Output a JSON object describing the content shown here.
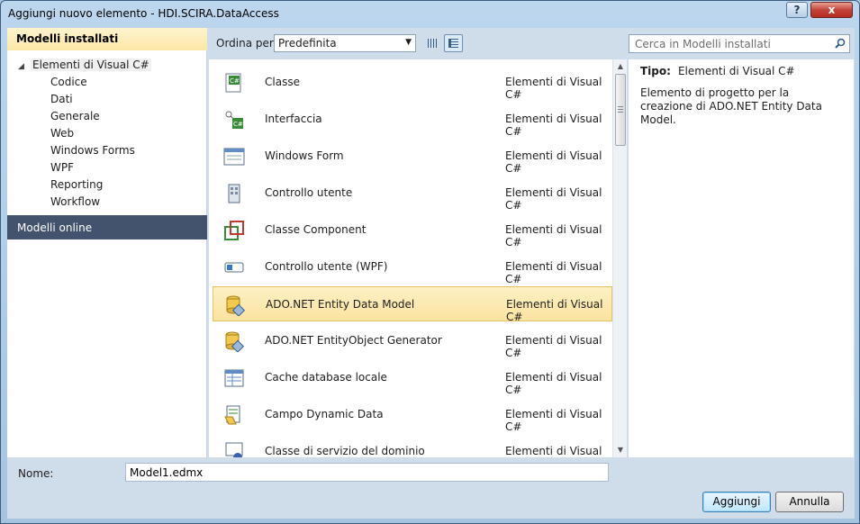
{
  "window": {
    "title": "Aggiungi nuovo elemento - HDI.SCIRA.DataAccess",
    "help_label": "?",
    "close_label": "x"
  },
  "sidebar": {
    "installed_header": "Modelli installati",
    "root_label": "Elementi di Visual C#",
    "children": [
      "Codice",
      "Dati",
      "Generale",
      "Web",
      "Windows Forms",
      "WPF",
      "Reporting",
      "Workflow"
    ],
    "online_header": "Modelli online"
  },
  "toolbar": {
    "sort_label": "Ordina per:",
    "sort_value": "Predefinita",
    "search_placeholder": "Cerca in Modelli installati"
  },
  "templates": [
    {
      "name": "Classe",
      "category": "Elementi di Visual C#",
      "icon": "class-icon"
    },
    {
      "name": "Interfaccia",
      "category": "Elementi di Visual C#",
      "icon": "interface-icon"
    },
    {
      "name": "Windows Form",
      "category": "Elementi di Visual C#",
      "icon": "windows-form-icon"
    },
    {
      "name": "Controllo utente",
      "category": "Elementi di Visual C#",
      "icon": "user-control-icon"
    },
    {
      "name": "Classe Component",
      "category": "Elementi di Visual C#",
      "icon": "component-class-icon"
    },
    {
      "name": "Controllo utente (WPF)",
      "category": "Elementi di Visual C#",
      "icon": "wpf-user-control-icon"
    },
    {
      "name": "ADO.NET Entity Data Model",
      "category": "Elementi di Visual C#",
      "icon": "entity-data-model-icon"
    },
    {
      "name": "ADO.NET EntityObject Generator",
      "category": "Elementi di Visual C#",
      "icon": "entityobject-generator-icon"
    },
    {
      "name": "Cache database locale",
      "category": "Elementi di Visual C#",
      "icon": "local-database-cache-icon"
    },
    {
      "name": "Campo Dynamic Data",
      "category": "Elementi di Visual C#",
      "icon": "dynamic-data-field-icon"
    },
    {
      "name": "Classe di servizio del dominio",
      "category": "Elementi di Visual C#",
      "icon": "domain-service-class-icon"
    }
  ],
  "selected_index": 6,
  "details": {
    "type_label": "Tipo:",
    "type_value": "Elementi di Visual C#",
    "description": "Elemento di progetto per la creazione di ADO.NET Entity Data Model."
  },
  "footer": {
    "name_label": "Nome:",
    "name_value": "Model1.edmx",
    "add_label": "Aggiungi",
    "cancel_label": "Annulla"
  },
  "colors": {
    "selection": "#fbe3a0",
    "online_header": "#44536d",
    "accent": "#3c7fb1"
  }
}
